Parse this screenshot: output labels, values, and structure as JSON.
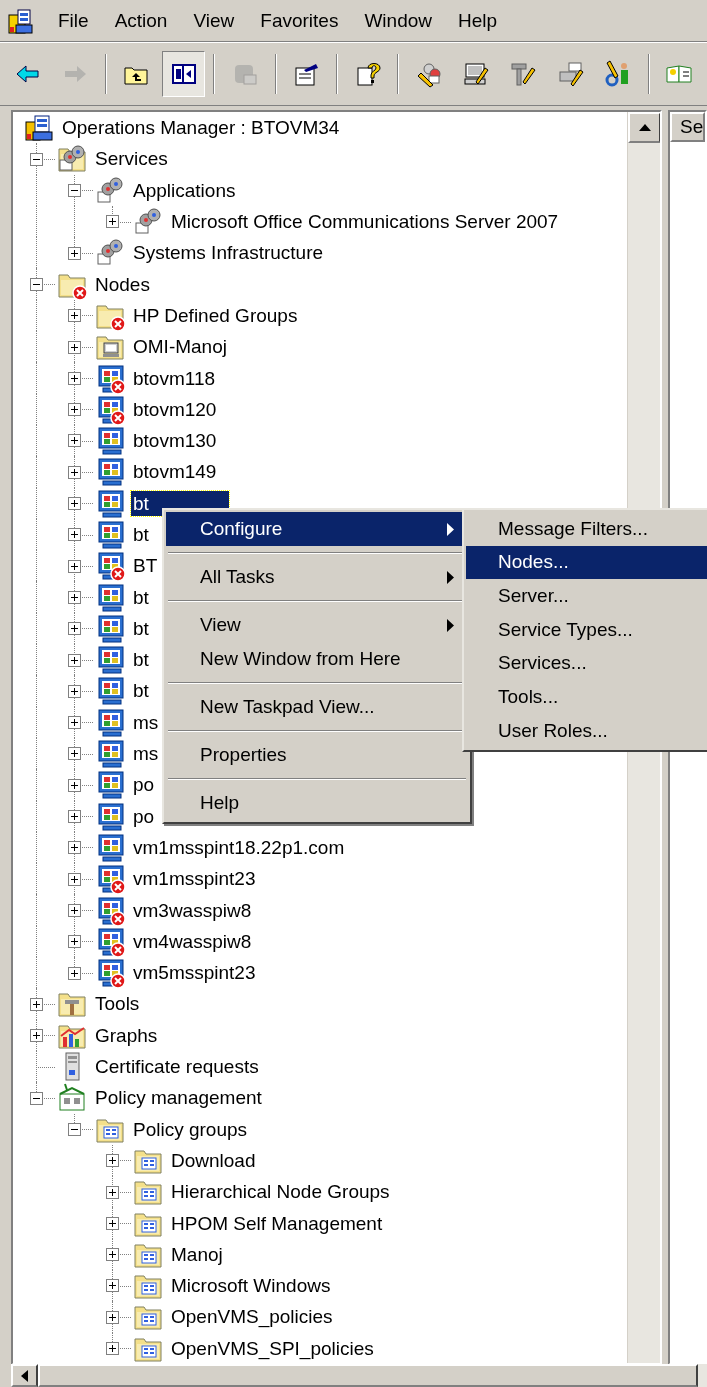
{
  "menu_bar": [
    {
      "label": "File"
    },
    {
      "label": "Action"
    },
    {
      "label": "View"
    },
    {
      "label": "Favorites"
    },
    {
      "label": "Window"
    },
    {
      "label": "Help"
    }
  ],
  "toolbar": [
    {
      "kind": "back",
      "disabled": false,
      "pressed": false
    },
    {
      "kind": "forward",
      "disabled": true,
      "pressed": false
    },
    {
      "kind": "separator"
    },
    {
      "kind": "up-folder",
      "disabled": false,
      "pressed": false
    },
    {
      "kind": "tree-toggle",
      "disabled": false,
      "pressed": true
    },
    {
      "kind": "separator"
    },
    {
      "kind": "export",
      "disabled": true,
      "pressed": false
    },
    {
      "kind": "separator"
    },
    {
      "kind": "properties",
      "disabled": false,
      "pressed": false
    },
    {
      "kind": "separator"
    },
    {
      "kind": "help",
      "disabled": false,
      "pressed": false
    },
    {
      "kind": "separator"
    },
    {
      "kind": "pencil-gears",
      "disabled": false,
      "pressed": false
    },
    {
      "kind": "pencil-computer",
      "disabled": false,
      "pressed": false
    },
    {
      "kind": "pencil-hammer",
      "disabled": false,
      "pressed": false
    },
    {
      "kind": "pencil-printer",
      "disabled": false,
      "pressed": false
    },
    {
      "kind": "pencil-person",
      "disabled": false,
      "pressed": false
    },
    {
      "kind": "separator"
    },
    {
      "kind": "book",
      "disabled": false,
      "pressed": false
    }
  ],
  "tree": {
    "label": "Operations Manager : BTOVM34",
    "kind": "console",
    "selected": false,
    "children": [
      {
        "label": "Services",
        "kind": "services",
        "expanded": true,
        "selected": false,
        "children": [
          {
            "label": "Applications",
            "kind": "service",
            "expanded": true,
            "selected": false,
            "children": [
              {
                "label": "Microsoft Office Communications Server 2007",
                "kind": "service",
                "expanded": false,
                "selected": false
              }
            ]
          },
          {
            "label": "Systems Infrastructure",
            "kind": "service",
            "expanded": false,
            "selected": false
          }
        ]
      },
      {
        "label": "Nodes",
        "kind": "folder-error",
        "expanded": true,
        "selected": false,
        "children": [
          {
            "label": "HP Defined Groups",
            "kind": "folder-error",
            "expanded": false,
            "selected": false
          },
          {
            "label": "OMI-Manoj",
            "kind": "folder-node",
            "expanded": false,
            "selected": false
          },
          {
            "label": "btovm118",
            "kind": "node-error",
            "expanded": false,
            "selected": false
          },
          {
            "label": "btovm120",
            "kind": "node-error",
            "expanded": false,
            "selected": false
          },
          {
            "label": "btovm130",
            "kind": "node",
            "expanded": false,
            "selected": false
          },
          {
            "label": "btovm149",
            "kind": "node",
            "expanded": false,
            "selected": false
          },
          {
            "label": "bt",
            "kind": "node",
            "expanded": false,
            "selected": true
          },
          {
            "label": "bt",
            "kind": "node",
            "expanded": false,
            "selected": false
          },
          {
            "label": "BT",
            "kind": "node-error",
            "expanded": false,
            "selected": false
          },
          {
            "label": "bt",
            "kind": "node",
            "expanded": false,
            "selected": false
          },
          {
            "label": "bt",
            "kind": "node",
            "expanded": false,
            "selected": false
          },
          {
            "label": "bt",
            "kind": "node",
            "expanded": false,
            "selected": false
          },
          {
            "label": "bt",
            "kind": "node",
            "expanded": false,
            "selected": false
          },
          {
            "label": "ms",
            "kind": "node",
            "expanded": false,
            "selected": false
          },
          {
            "label": "ms",
            "kind": "node",
            "expanded": false,
            "selected": false
          },
          {
            "label": "po",
            "kind": "node",
            "expanded": false,
            "selected": false
          },
          {
            "label": "po",
            "kind": "node",
            "expanded": false,
            "selected": false
          },
          {
            "label": "vm1msspint18.22p1.com",
            "kind": "node",
            "expanded": false,
            "selected": false
          },
          {
            "label": "vm1msspint23",
            "kind": "node-error",
            "expanded": false,
            "selected": false
          },
          {
            "label": "vm3wasspiw8",
            "kind": "node-error",
            "expanded": false,
            "selected": false
          },
          {
            "label": "vm4wasspiw8",
            "kind": "node-error",
            "expanded": false,
            "selected": false
          },
          {
            "label": "vm5msspint23",
            "kind": "node-error",
            "expanded": false,
            "selected": false
          }
        ]
      },
      {
        "label": "Tools",
        "kind": "tools",
        "expanded": false,
        "selected": false
      },
      {
        "label": "Graphs",
        "kind": "graphs",
        "expanded": false,
        "selected": false
      },
      {
        "label": "Certificate requests",
        "kind": "certificate",
        "selected": false
      },
      {
        "label": "Policy management",
        "kind": "policy",
        "expanded": true,
        "selected": false,
        "children": [
          {
            "label": "Policy groups",
            "kind": "policy-folder",
            "expanded": true,
            "selected": false,
            "children": [
              {
                "label": "Download",
                "kind": "policy-folder",
                "expanded": false,
                "selected": false
              },
              {
                "label": "Hierarchical Node Groups",
                "kind": "policy-folder",
                "expanded": false,
                "selected": false
              },
              {
                "label": "HPOM Self Management",
                "kind": "policy-folder",
                "expanded": false,
                "selected": false
              },
              {
                "label": "Manoj",
                "kind": "policy-folder",
                "expanded": false,
                "selected": false
              },
              {
                "label": "Microsoft Windows",
                "kind": "policy-folder",
                "expanded": false,
                "selected": false
              },
              {
                "label": "OpenVMS_policies",
                "kind": "policy-folder",
                "expanded": false,
                "selected": false
              },
              {
                "label": "OpenVMS_SPI_policies",
                "kind": "policy-folder",
                "expanded": false,
                "selected": false
              }
            ]
          }
        ]
      }
    ]
  },
  "right_pane": {
    "header": "Se"
  },
  "context_menu": [
    {
      "kind": "item",
      "label": "Configure",
      "submenu": true,
      "selected": true
    },
    {
      "kind": "separator"
    },
    {
      "kind": "item",
      "label": "All Tasks",
      "submenu": true,
      "selected": false
    },
    {
      "kind": "separator"
    },
    {
      "kind": "item",
      "label": "View",
      "submenu": true,
      "selected": false
    },
    {
      "kind": "item",
      "label": "New Window from Here",
      "submenu": false,
      "selected": false
    },
    {
      "kind": "separator"
    },
    {
      "kind": "item",
      "label": "New Taskpad View...",
      "submenu": false,
      "selected": false
    },
    {
      "kind": "separator"
    },
    {
      "kind": "item",
      "label": "Properties",
      "submenu": false,
      "selected": false
    },
    {
      "kind": "separator"
    },
    {
      "kind": "item",
      "label": "Help",
      "submenu": false,
      "selected": false
    }
  ],
  "submenu": [
    {
      "label": "Message Filters...",
      "selected": false
    },
    {
      "label": "Nodes...",
      "selected": true
    },
    {
      "label": "Server...",
      "selected": false
    },
    {
      "label": "Service Types...",
      "selected": false
    },
    {
      "label": "Services...",
      "selected": false
    },
    {
      "label": "Tools...",
      "selected": false
    },
    {
      "label": "User Roles...",
      "selected": false
    }
  ]
}
